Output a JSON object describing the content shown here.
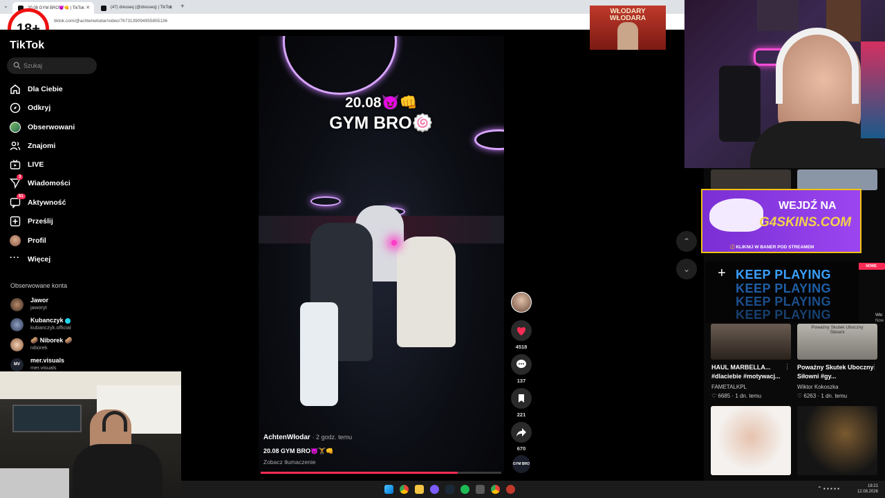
{
  "browser": {
    "tabs": [
      {
        "title": "20.08 GYM BRO😈👊 | TikTok"
      },
      {
        "title": "(47) dresseq (@dresseq) | TikTok"
      }
    ],
    "new_tab_icon": "plus-icon",
    "url": "tiktok.com/@achtenwlodar/video/7673139094955855136"
  },
  "age_badge": "18+",
  "sidebar": {
    "logo": "TikTok",
    "search_placeholder": "Szukaj",
    "items": [
      {
        "label": "Dla Ciebie",
        "icon": "home-icon"
      },
      {
        "label": "Odkryj",
        "icon": "compass-icon"
      },
      {
        "label": "Obserwowani",
        "icon": "following-icon"
      },
      {
        "label": "Znajomi",
        "icon": "friends-icon"
      },
      {
        "label": "LIVE",
        "icon": "live-icon"
      },
      {
        "label": "Wiadomości",
        "icon": "messages-icon",
        "badge": "3"
      },
      {
        "label": "Aktywność",
        "icon": "activity-icon",
        "badge": "51"
      },
      {
        "label": "Prześlij",
        "icon": "upload-icon"
      },
      {
        "label": "Profil",
        "icon": "profile-icon"
      },
      {
        "label": "Więcej",
        "icon": "more-icon"
      }
    ],
    "followed_title": "Obserwowane konta",
    "accounts": [
      {
        "name": "Jawor",
        "handle": "jaworyt"
      },
      {
        "name": "Kubanczyk",
        "handle": "kubanczyk.official"
      },
      {
        "name": "🥔 Niborek 🥔",
        "handle": "niborek"
      },
      {
        "name": "mer.visuals",
        "handle": "mer.visuals"
      }
    ]
  },
  "video": {
    "title_line1": "20.08😈👊",
    "title_line2": "GYM BRO🍥",
    "author": "AchtenWłodar",
    "posted": "· 2 godz. temu",
    "caption": "20.08 GYM BRO😈🏋👊",
    "translate": "Zobacz tłumaczenie",
    "progress": 0.82
  },
  "actions": {
    "likes": "4518",
    "comments": "137",
    "saves": "221",
    "shares": "670",
    "sound_label": "GYM BRO"
  },
  "overlay": {
    "top_banner_line1": "WŁODARY",
    "top_banner_line2": "WŁODARA",
    "promo_line1": "WEJDŹ NA",
    "promo_line2": "G4SKINS.COM",
    "promo_note": "KLIKNIJ W BANER POD STREAMEM",
    "keep_playing": "KEEP PLAYING"
  },
  "recommended": [
    {
      "title": "HAUL MARBELLA... #dlaciebie #motywacj...",
      "author": "FAMETALKPL",
      "likes": "6685",
      "ago": "1 dn. temu",
      "thumb_text": ""
    },
    {
      "title": "Poważny Skutek Uboczny Siłowni #gy...",
      "author": "Wiktor Kokoszka",
      "likes": "6263",
      "ago": "1 dn. temu",
      "thumb_text": "Poważny Skutek Uboczny Siłowni"
    }
  ],
  "right_notifications": [
    "NOWE",
    "Wło",
    "Now"
  ],
  "taskbar": {
    "time": "18:21",
    "date": "12.08.2026"
  },
  "colors": {
    "accent": "#fe2c55",
    "promo_purple": "#8b3ce6",
    "promo_border": "#f2c40f",
    "keep_playing_blue": "#3aa0ff"
  }
}
